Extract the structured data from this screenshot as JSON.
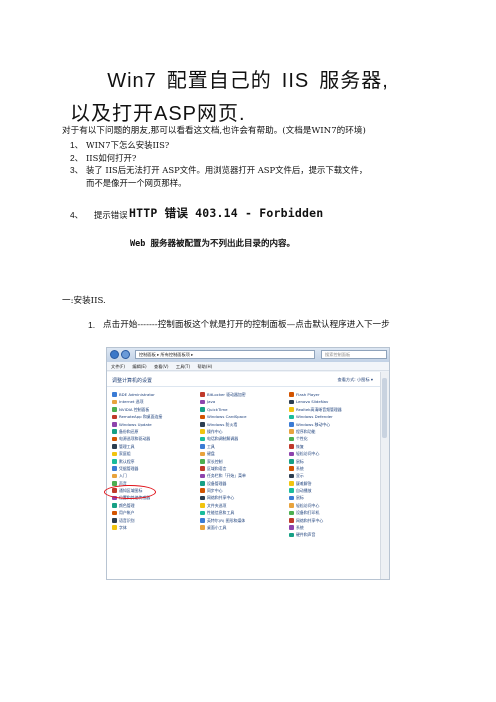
{
  "title": {
    "line1_parts": [
      "Win7",
      "配置自己的",
      "IIS",
      "服务器,"
    ],
    "line2": "以及打开ASP网页."
  },
  "intro": "对于有以下问题的朋友,那可以看看这文档,也许会有帮助。(文档是WIN7的环境)",
  "questions": [
    {
      "num": "1、",
      "text": "WIN7下怎么安装IIS?"
    },
    {
      "num": "2、",
      "text": "IIS如何打开?"
    },
    {
      "num": "3、",
      "text": "装了 IIS后无法打开 ASP文件。用浏览器打开 ASP文件后，提示下载文件，",
      "cont": "而不是像开一个网页那样。"
    }
  ],
  "q4": {
    "num": "4、",
    "prefix": "提示错误",
    "error": "HTTP 错误 403.14 - Forbidden",
    "sub": "Web 服务器被配置为不列出此目录的内容。"
  },
  "section_title": "一:安装IIS.",
  "step1": {
    "num": "1.",
    "text": "点击开始-------控制面板这个就是打开的控制面板—点击默认程序进入下一步"
  },
  "screenshot": {
    "address": "控制面板 ▸ 所有控制面板项 ▸",
    "search": "搜索控制面板",
    "menu": [
      "文件(F)",
      "编辑(E)",
      "查看(V)",
      "工具(T)",
      "帮助(H)"
    ],
    "content_title": "调整计算机的设置",
    "view_by": "查看方式: 小图标 ▾",
    "columns": [
      [
        "BDE Administrator",
        "Internet 选项",
        "NVIDIA 控制面板",
        "RemoteApp 和桌面连接",
        "Windows Update",
        "备份和还原",
        "电源选项和驱动器",
        "管理工具",
        "家庭组",
        "默认程序",
        "凭据管理器",
        "入门",
        "声音",
        "通知区域图标",
        "位置和其他传感器",
        "颜色管理",
        "用户帐户",
        "语音识别",
        "字体"
      ],
      [
        "BitLocker 驱动器加密",
        "Java",
        "QuickTime",
        "Windows CardSpace",
        "Windows 防火墙",
        "操作中心",
        "电话和调制解调器",
        "工具",
        "键盘",
        "家长控制",
        "区域和语言",
        "任务栏和「开始」菜单",
        "设备管理器",
        "同步中心",
        "网络和共享中心",
        "文件夹选项",
        "性能信息和工具",
        "英特尔(R) 图形和媒体",
        "桌面小工具"
      ],
      [
        "Flash Player",
        "Lenovo SlideNav",
        "Realtek高清晰音频管理器",
        "Windows Defender",
        "Windows 移动中心",
        "程序和功能",
        "个性化",
        "恢复",
        "轻松访问中心",
        "鼠标",
        "系统",
        "显示",
        "疑难解答",
        "自动播放",
        "鼠标",
        "轻松访问中心",
        "设备和打印机",
        "网络和共享中心",
        "系统",
        "硬件和声音"
      ]
    ],
    "highlighted_item": "默认程序",
    "accent": "#e0141b"
  }
}
